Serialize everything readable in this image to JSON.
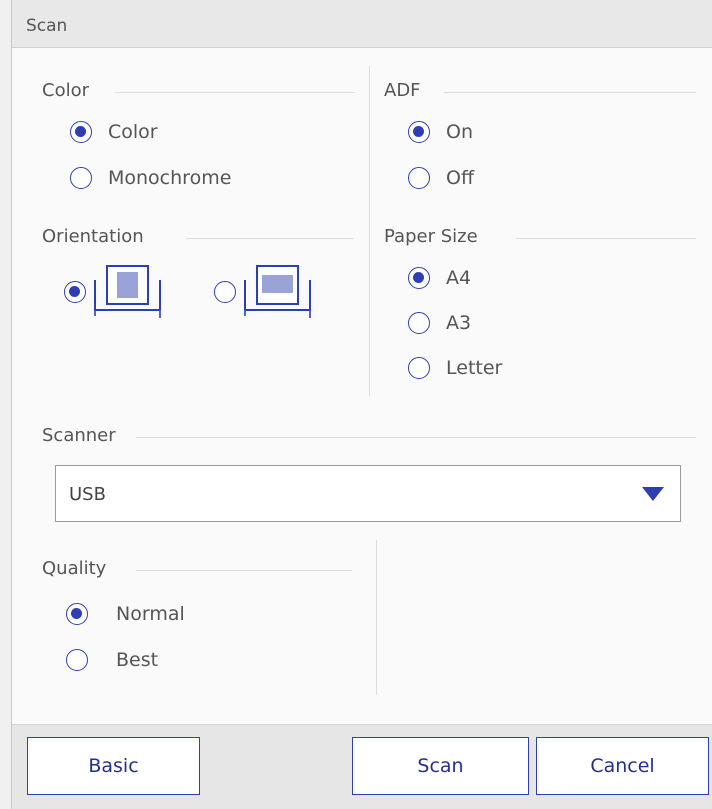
{
  "window": {
    "title": "Scan"
  },
  "color_group": {
    "label": "Color",
    "options": [
      {
        "label": "Color",
        "selected": true
      },
      {
        "label": "Monochrome",
        "selected": false
      }
    ]
  },
  "orientation_group": {
    "label": "Orientation",
    "options": [
      {
        "icon": "portrait-orientation-icon",
        "selected": true
      },
      {
        "icon": "landscape-orientation-icon",
        "selected": false
      }
    ]
  },
  "adf_group": {
    "label": "ADF",
    "options": [
      {
        "label": "On",
        "selected": true
      },
      {
        "label": "Off",
        "selected": false
      }
    ]
  },
  "paper_size_group": {
    "label": "Paper Size",
    "options": [
      {
        "label": "A4",
        "selected": true
      },
      {
        "label": "A3",
        "selected": false
      },
      {
        "label": "Letter",
        "selected": false
      }
    ]
  },
  "scanner_group": {
    "label": "Scanner",
    "selected_value": "USB",
    "dropdown_icon": "triangle-down-icon"
  },
  "quality_group": {
    "label": "Quality",
    "options": [
      {
        "label": "Normal",
        "selected": true
      },
      {
        "label": "Best",
        "selected": false
      }
    ]
  },
  "footer": {
    "basic_label": "Basic",
    "scan_label": "Scan",
    "cancel_label": "Cancel"
  },
  "colors": {
    "accent": "#2e3fb3",
    "button_text": "#22308f",
    "background": "#fafafa",
    "titlebar": "#e8e8e8"
  }
}
